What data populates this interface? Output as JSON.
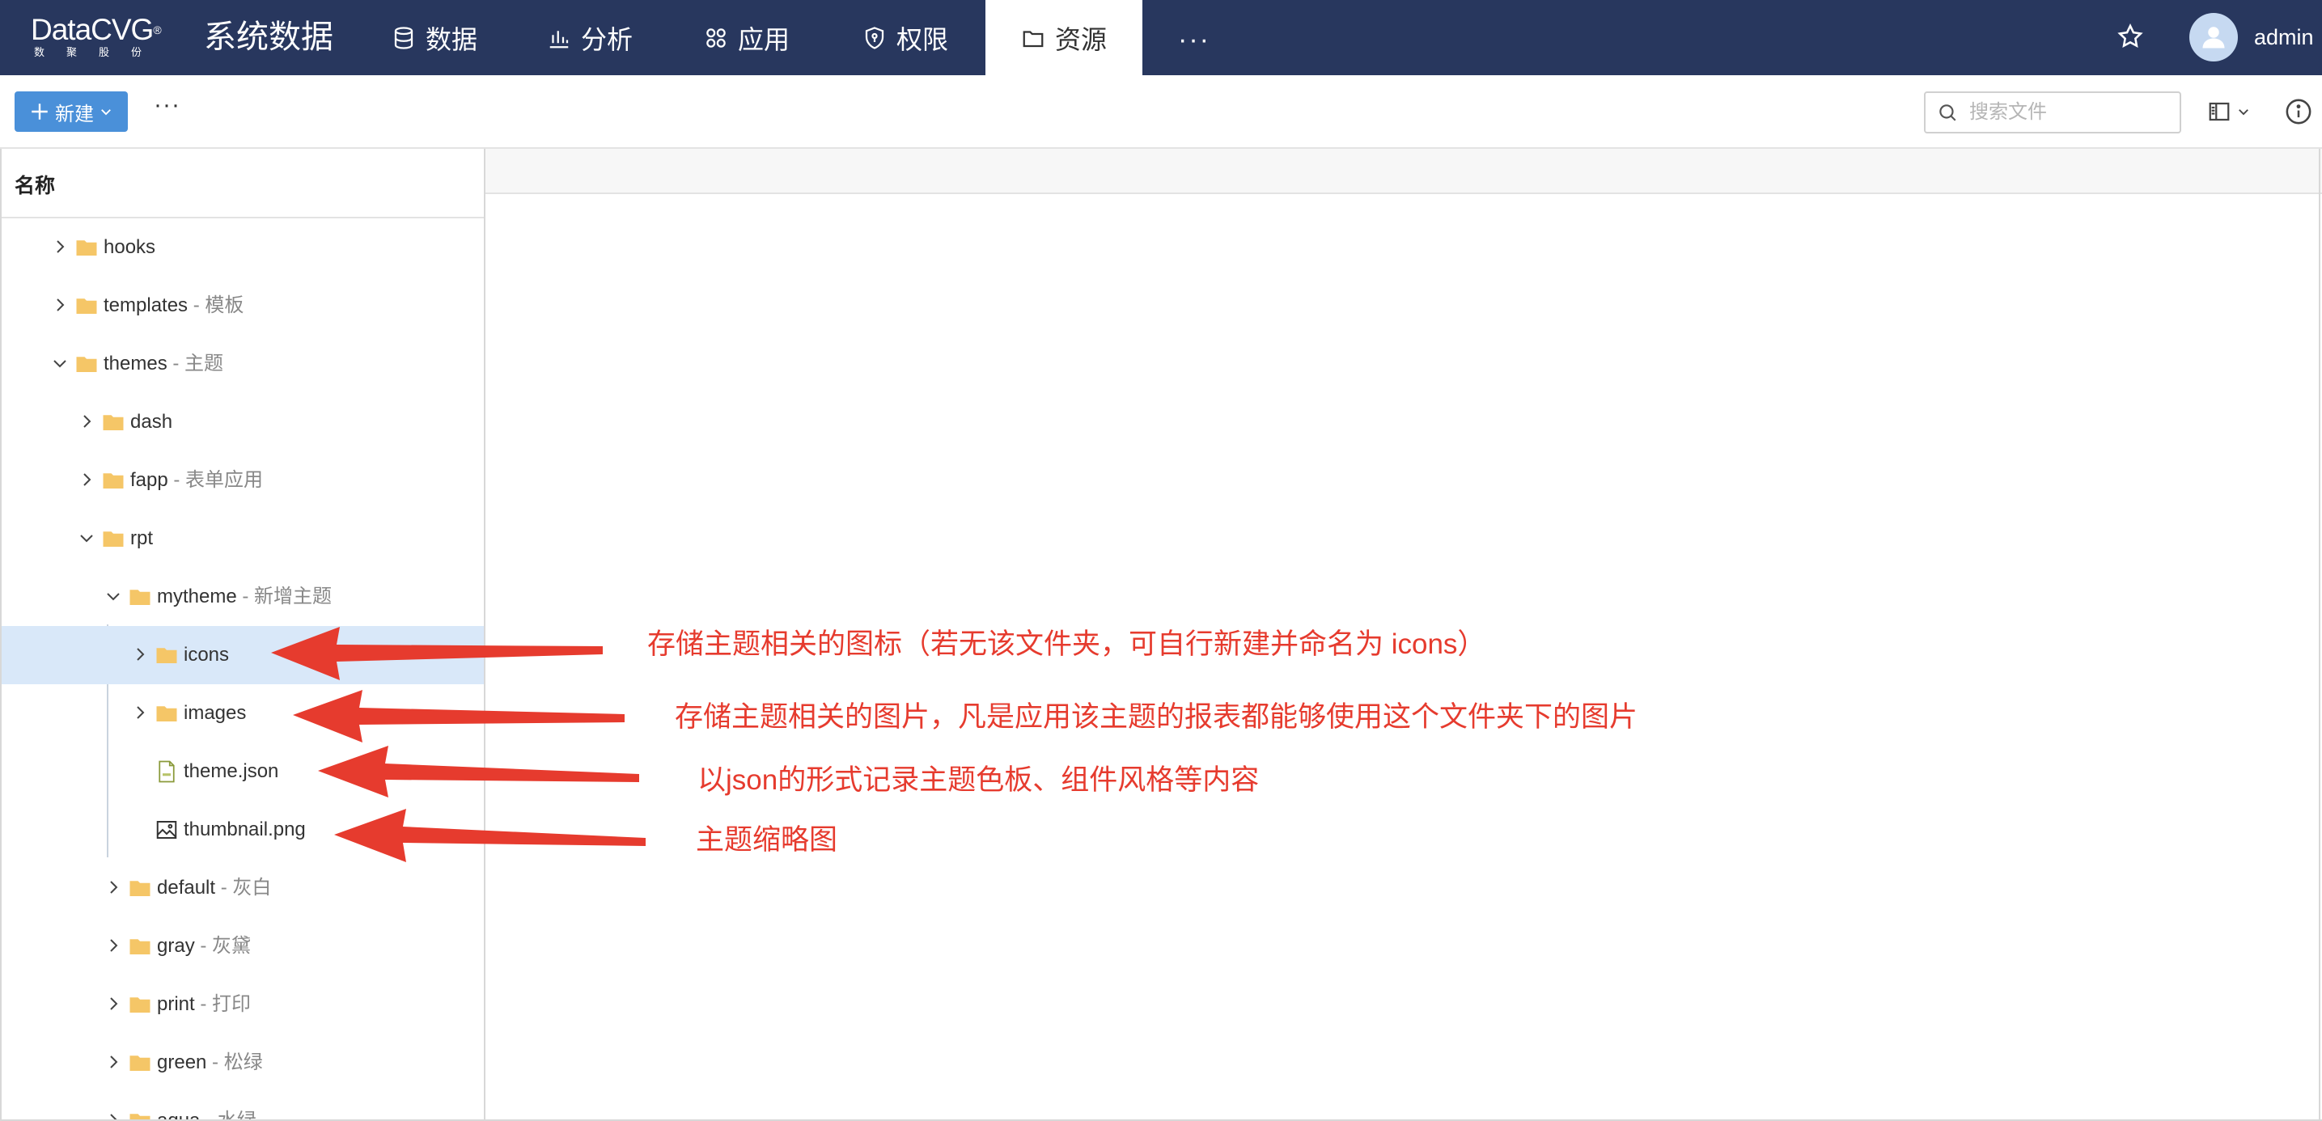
{
  "logo": {
    "main": "DataCVG",
    "reg": "®",
    "sub": "数聚股份"
  },
  "system_title": "系统数据",
  "nav": [
    {
      "label": "数据",
      "icon": "database-icon"
    },
    {
      "label": "分析",
      "icon": "bar-chart-icon"
    },
    {
      "label": "应用",
      "icon": "apps-icon"
    },
    {
      "label": "权限",
      "icon": "shield-icon"
    },
    {
      "label": "资源",
      "icon": "folder-icon",
      "active": true
    }
  ],
  "nav_more": "···",
  "user": {
    "name": "admin"
  },
  "toolbar": {
    "new_label": "新建",
    "more_label": "···",
    "search_placeholder": "搜索文件"
  },
  "tree": {
    "header": "名称",
    "items": [
      {
        "name": "hooks",
        "desc": "",
        "type": "folder",
        "expanded": false
      },
      {
        "name": "templates",
        "desc": " - 模板",
        "type": "folder",
        "expanded": false
      },
      {
        "name": "themes",
        "desc": " - 主题",
        "type": "folder",
        "expanded": true
      },
      {
        "name": "dash",
        "desc": "",
        "type": "folder",
        "expanded": false
      },
      {
        "name": "fapp",
        "desc": " - 表单应用",
        "type": "folder",
        "expanded": false
      },
      {
        "name": "rpt",
        "desc": "",
        "type": "folder",
        "expanded": true
      },
      {
        "name": "mytheme",
        "desc": " - 新增主题",
        "type": "folder",
        "expanded": true
      },
      {
        "name": "icons",
        "desc": "",
        "type": "folder",
        "expanded": false,
        "selected": true
      },
      {
        "name": "images",
        "desc": "",
        "type": "folder",
        "expanded": false
      },
      {
        "name": "theme.json",
        "desc": "",
        "type": "json-file"
      },
      {
        "name": "thumbnail.png",
        "desc": "",
        "type": "image-file"
      },
      {
        "name": "default",
        "desc": " - 灰白",
        "type": "folder",
        "expanded": false
      },
      {
        "name": "gray",
        "desc": " - 灰黛",
        "type": "folder",
        "expanded": false
      },
      {
        "name": "print",
        "desc": " - 打印",
        "type": "folder",
        "expanded": false
      },
      {
        "name": "green",
        "desc": " - 松绿",
        "type": "folder",
        "expanded": false
      },
      {
        "name": "aqua",
        "desc": " - 水绿",
        "type": "folder",
        "expanded": false
      }
    ]
  },
  "annotations": [
    "存储主题相关的图标（若无该文件夹，可自行新建并命名为 icons）",
    "存储主题相关的图片，凡是应用该主题的报表都能够使用这个文件夹下的图片",
    "以json的形式记录主题色板、组件风格等内容",
    "主题缩略图"
  ],
  "colors": {
    "nav_bg": "#28375e",
    "primary": "#4a90d9",
    "selected_row": "#d9e8f9",
    "folder": "#f5c667",
    "annotation": "#e63b2e"
  }
}
